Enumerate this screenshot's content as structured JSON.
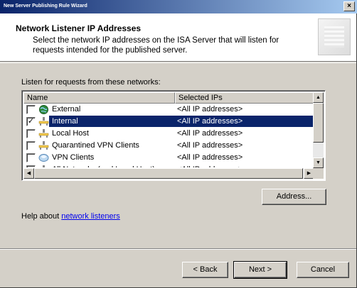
{
  "window": {
    "title": "New Server Publishing Rule Wizard",
    "close_glyph": "×"
  },
  "header": {
    "title": "Network Listener IP Addresses",
    "description": "Select the network IP addresses on the ISA Server that will listen for requests intended for the published server."
  },
  "listener": {
    "label": "Listen for requests from these networks:",
    "columns": [
      "Name",
      "Selected IPs"
    ],
    "rows": [
      {
        "name": "External",
        "ips": "<All IP addresses>",
        "checked": false,
        "selected": false,
        "icon": "globe-icon"
      },
      {
        "name": "Internal",
        "ips": "<All IP addresses>",
        "checked": true,
        "selected": true,
        "icon": "network-icon"
      },
      {
        "name": "Local Host",
        "ips": "<All IP addresses>",
        "checked": false,
        "selected": false,
        "icon": "network-icon"
      },
      {
        "name": "Quarantined VPN Clients",
        "ips": "<All IP addresses>",
        "checked": false,
        "selected": false,
        "icon": "network-icon"
      },
      {
        "name": "VPN Clients",
        "ips": "<All IP addresses>",
        "checked": false,
        "selected": false,
        "icon": "vpn-clients-icon"
      },
      {
        "name": "All Networks (and Local Host)",
        "ips": "<All IP addresses>",
        "checked": false,
        "selected": false,
        "icon": "network-icon"
      }
    ]
  },
  "address_button": "Address...",
  "help": {
    "prefix": "Help about ",
    "link": "network listeners"
  },
  "footer": {
    "back": "< Back",
    "next": "Next >",
    "cancel": "Cancel"
  }
}
